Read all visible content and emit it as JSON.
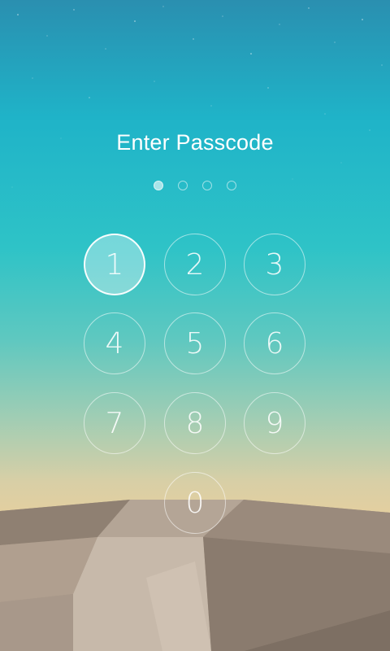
{
  "screen": {
    "title": "Enter Passcode",
    "entered_digits": 1,
    "passcode_length": 4
  },
  "keypad": {
    "keys": [
      {
        "label": "1",
        "pressed": true
      },
      {
        "label": "2",
        "pressed": false
      },
      {
        "label": "3",
        "pressed": false
      },
      {
        "label": "4",
        "pressed": false
      },
      {
        "label": "5",
        "pressed": false
      },
      {
        "label": "6",
        "pressed": false
      },
      {
        "label": "7",
        "pressed": false
      },
      {
        "label": "8",
        "pressed": false
      },
      {
        "label": "9",
        "pressed": false
      },
      {
        "label": "0",
        "pressed": false
      }
    ]
  },
  "colors": {
    "sky_top": "#2a8fb0",
    "sky_mid": "#2ec3c7",
    "horizon": "#e6cf9e",
    "ground": "#a39383"
  }
}
